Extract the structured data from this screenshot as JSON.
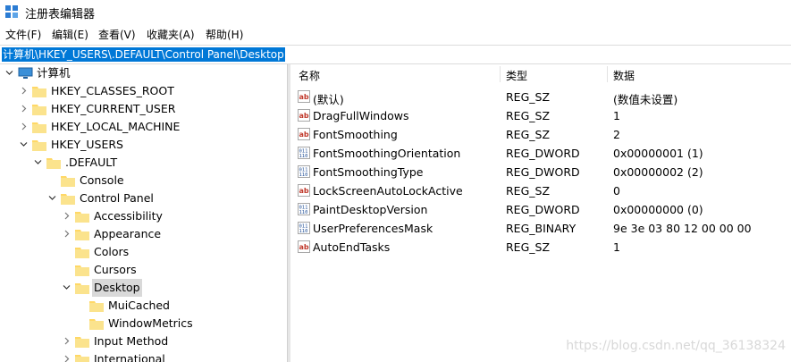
{
  "window": {
    "title": "注册表编辑器"
  },
  "menu": [
    "文件(F)",
    "编辑(E)",
    "查看(V)",
    "收藏夹(A)",
    "帮助(H)"
  ],
  "address": "计算机\\HKEY_USERS\\.DEFAULT\\Control Panel\\Desktop",
  "tree": {
    "root": "计算机",
    "nodes": [
      "HKEY_CLASSES_ROOT",
      "HKEY_CURRENT_USER",
      "HKEY_LOCAL_MACHINE",
      "HKEY_USERS",
      ".DEFAULT",
      "Console",
      "Control Panel",
      "Accessibility",
      "Appearance",
      "Colors",
      "Cursors",
      "Desktop",
      "MuiCached",
      "WindowMetrics",
      "Input Method",
      "International"
    ]
  },
  "list": {
    "headers": {
      "name": "名称",
      "type": "类型",
      "data": "数据"
    },
    "rows": [
      {
        "name": "(默认)",
        "type": "REG_SZ",
        "data": "(数值未设置)",
        "icon": "string-value-icon"
      },
      {
        "name": "DragFullWindows",
        "type": "REG_SZ",
        "data": "1",
        "icon": "string-value-icon"
      },
      {
        "name": "FontSmoothing",
        "type": "REG_SZ",
        "data": "2",
        "icon": "string-value-icon"
      },
      {
        "name": "FontSmoothingOrientation",
        "type": "REG_DWORD",
        "data": "0x00000001 (1)",
        "icon": "binary-value-icon"
      },
      {
        "name": "FontSmoothingType",
        "type": "REG_DWORD",
        "data": "0x00000002 (2)",
        "icon": "binary-value-icon"
      },
      {
        "name": "LockScreenAutoLockActive",
        "type": "REG_SZ",
        "data": "0",
        "icon": "string-value-icon"
      },
      {
        "name": "PaintDesktopVersion",
        "type": "REG_DWORD",
        "data": "0x00000000 (0)",
        "icon": "binary-value-icon"
      },
      {
        "name": "UserPreferencesMask",
        "type": "REG_BINARY",
        "data": "9e 3e 03 80 12 00 00 00",
        "icon": "binary-value-icon"
      },
      {
        "name": "AutoEndTasks",
        "type": "REG_SZ",
        "data": "1",
        "icon": "string-value-icon"
      }
    ]
  },
  "watermark": "https://blog.csdn.net/qq_36138324",
  "colors": {
    "selection": "#0078d7",
    "folder": "#ffd866",
    "tree_selected": "#d9d9d9"
  }
}
